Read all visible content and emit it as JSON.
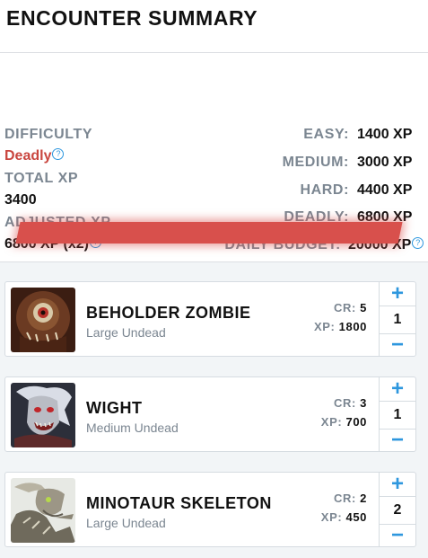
{
  "header": {
    "title": "ENCOUNTER SUMMARY"
  },
  "summary": {
    "difficulty_label": "DIFFICULTY",
    "difficulty_value": "Deadly",
    "total_xp_label": "TOTAL XP",
    "total_xp_value": "3400",
    "adjusted_xp_label": "ADJUSTED XP",
    "adjusted_xp_value": "6800 XP (x2)",
    "help_glyph": "?",
    "thresholds": [
      {
        "label": "EASY:",
        "value": "1400 XP"
      },
      {
        "label": "MEDIUM:",
        "value": "3000 XP"
      },
      {
        "label": "HARD:",
        "value": "4400 XP"
      },
      {
        "label": "DEADLY:",
        "value": "6800 XP"
      },
      {
        "label": "DAILY BUDGET:",
        "value": "20000 XP"
      }
    ],
    "bar_color": "#d8504c"
  },
  "monsters": [
    {
      "name": "BEHOLDER ZOMBIE",
      "type": "Large Undead",
      "cr_label": "CR:",
      "cr": "5",
      "xp_label": "XP:",
      "xp": "1800",
      "qty": "1",
      "plus": "+",
      "minus": "−"
    },
    {
      "name": "WIGHT",
      "type": "Medium Undead",
      "cr_label": "CR:",
      "cr": "3",
      "xp_label": "XP:",
      "xp": "700",
      "qty": "1",
      "plus": "+",
      "minus": "−"
    },
    {
      "name": "MINOTAUR SKELETON",
      "type": "Large Undead",
      "cr_label": "CR:",
      "cr": "2",
      "xp_label": "XP:",
      "xp": "450",
      "qty": "2",
      "plus": "+",
      "minus": "−"
    }
  ],
  "colors": {
    "accent": "#2e97de",
    "deadly": "#c9463f",
    "label_gray": "#7b8691"
  }
}
